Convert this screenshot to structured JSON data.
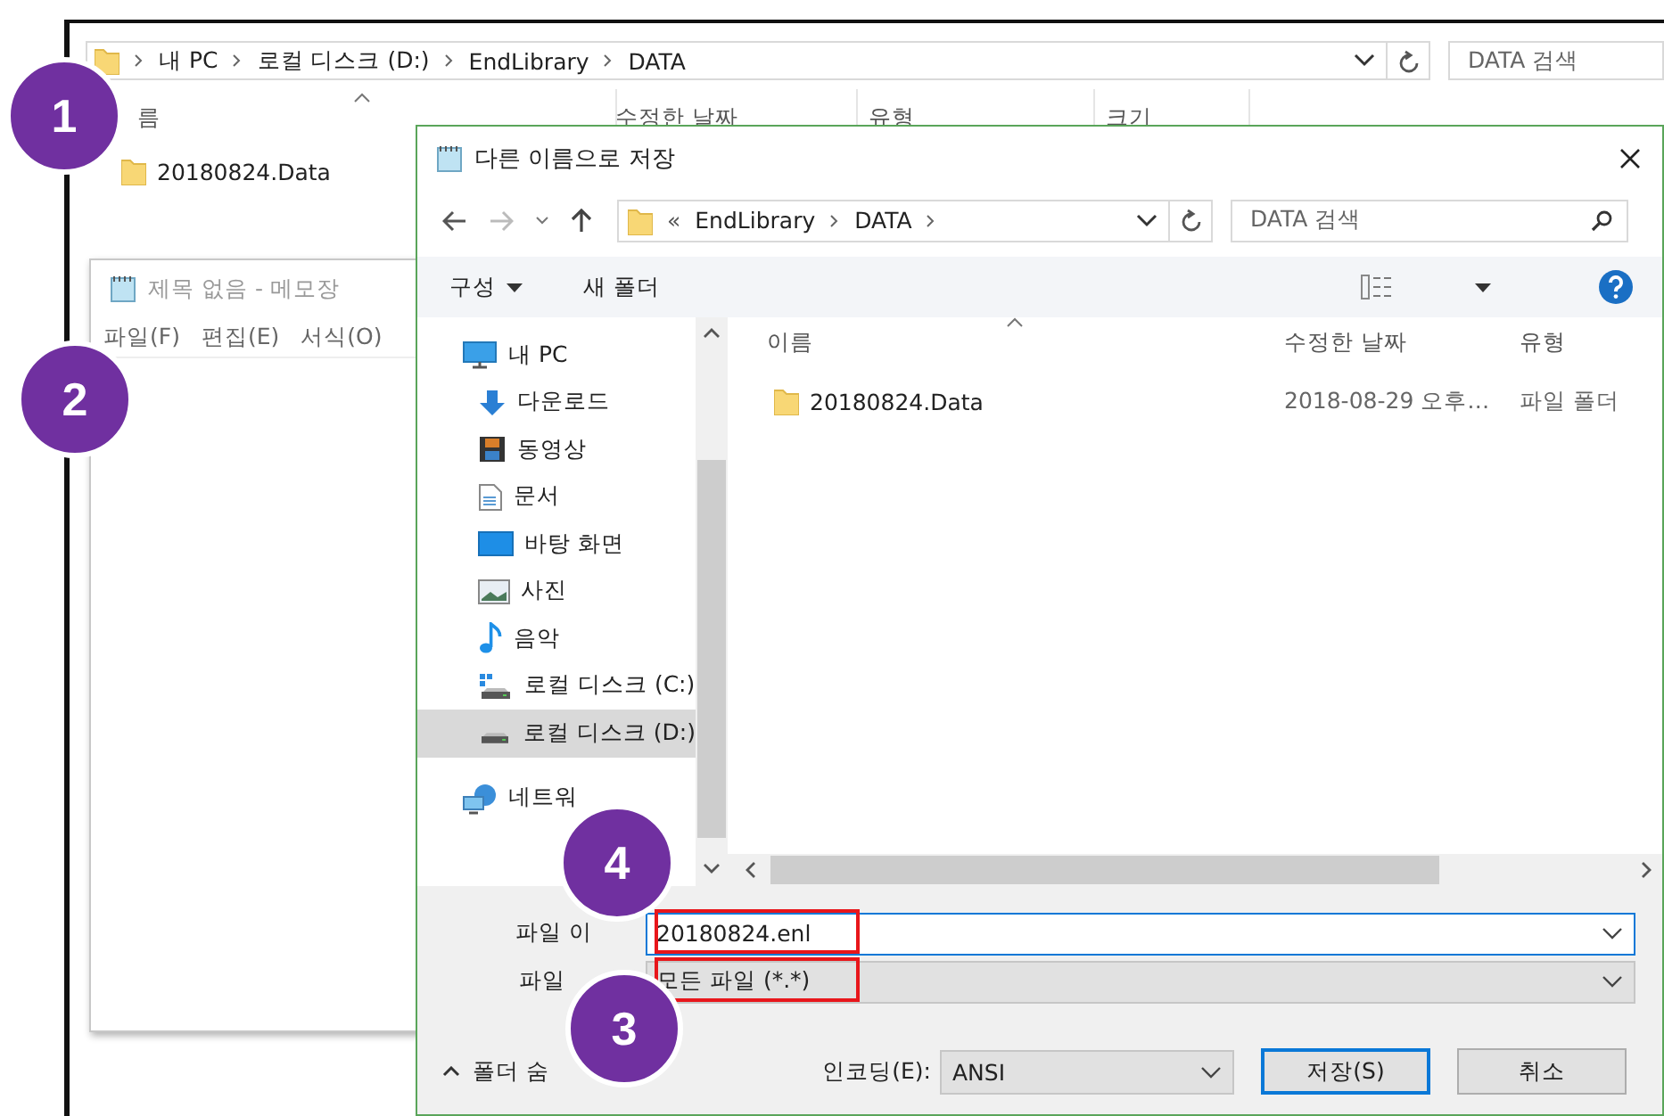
{
  "explorer": {
    "breadcrumb": [
      "내 PC",
      "로컬 디스크 (D:)",
      "EndLibrary",
      "DATA"
    ],
    "search": {
      "placeholder": "DATA 검색"
    },
    "columns": [
      "름",
      "수정한 날짜",
      "유형",
      "크기"
    ],
    "rows": [
      {
        "name": "20180824.Data"
      }
    ]
  },
  "notepad": {
    "title": "제목 없음 - 메모장",
    "menu": [
      "파일(F)",
      "편집(E)",
      "서식(O)"
    ]
  },
  "dialog": {
    "title": "다른 이름으로 저장",
    "address": {
      "prefix": "«",
      "crumbs": [
        "EndLibrary",
        "DATA"
      ]
    },
    "search": {
      "placeholder": "DATA 검색"
    },
    "toolbar": [
      {
        "label": "구성",
        "dropdown": true
      },
      {
        "label": "새 폴더",
        "dropdown": false
      }
    ],
    "nav": [
      {
        "label": "내 PC",
        "kind": "pc",
        "selected": false,
        "children": [
          {
            "label": "다운로드",
            "kind": "download",
            "selected": false
          },
          {
            "label": "동영상",
            "kind": "video",
            "selected": false
          },
          {
            "label": "문서",
            "kind": "document",
            "selected": false
          },
          {
            "label": "바탕 화면",
            "kind": "desktop",
            "selected": false
          },
          {
            "label": "사진",
            "kind": "picture",
            "selected": false
          },
          {
            "label": "음악",
            "kind": "music",
            "selected": false
          },
          {
            "label": "로컬 디스크 (C:)",
            "kind": "system-drive",
            "selected": false
          },
          {
            "label": "로컬 디스크 (D:)",
            "kind": "drive",
            "selected": true
          }
        ]
      },
      {
        "label": "네트워",
        "kind": "network",
        "selected": false
      }
    ],
    "columns": [
      "이름",
      "수정한 날짜",
      "유형"
    ],
    "rows": [
      {
        "name": "20180824.Data",
        "modified": "2018-08-29 오후…",
        "type": "파일 폴더"
      }
    ],
    "filename": {
      "label": "파일 이",
      "value": "20180824.enl",
      "highlighted": true
    },
    "filetype": {
      "label": "파일",
      "value": "모든 파일 (*.*)",
      "highlighted": true
    },
    "hide_folders": "폴더 숨",
    "encoding": {
      "label": "인코딩(E):",
      "value": "ANSI"
    },
    "buttons": [
      {
        "label": "저장(S)",
        "default": true
      },
      {
        "label": "취소",
        "default": false
      }
    ]
  },
  "callouts": [
    {
      "number": "1"
    },
    {
      "number": "2"
    },
    {
      "number": "4"
    },
    {
      "number": "3"
    }
  ]
}
